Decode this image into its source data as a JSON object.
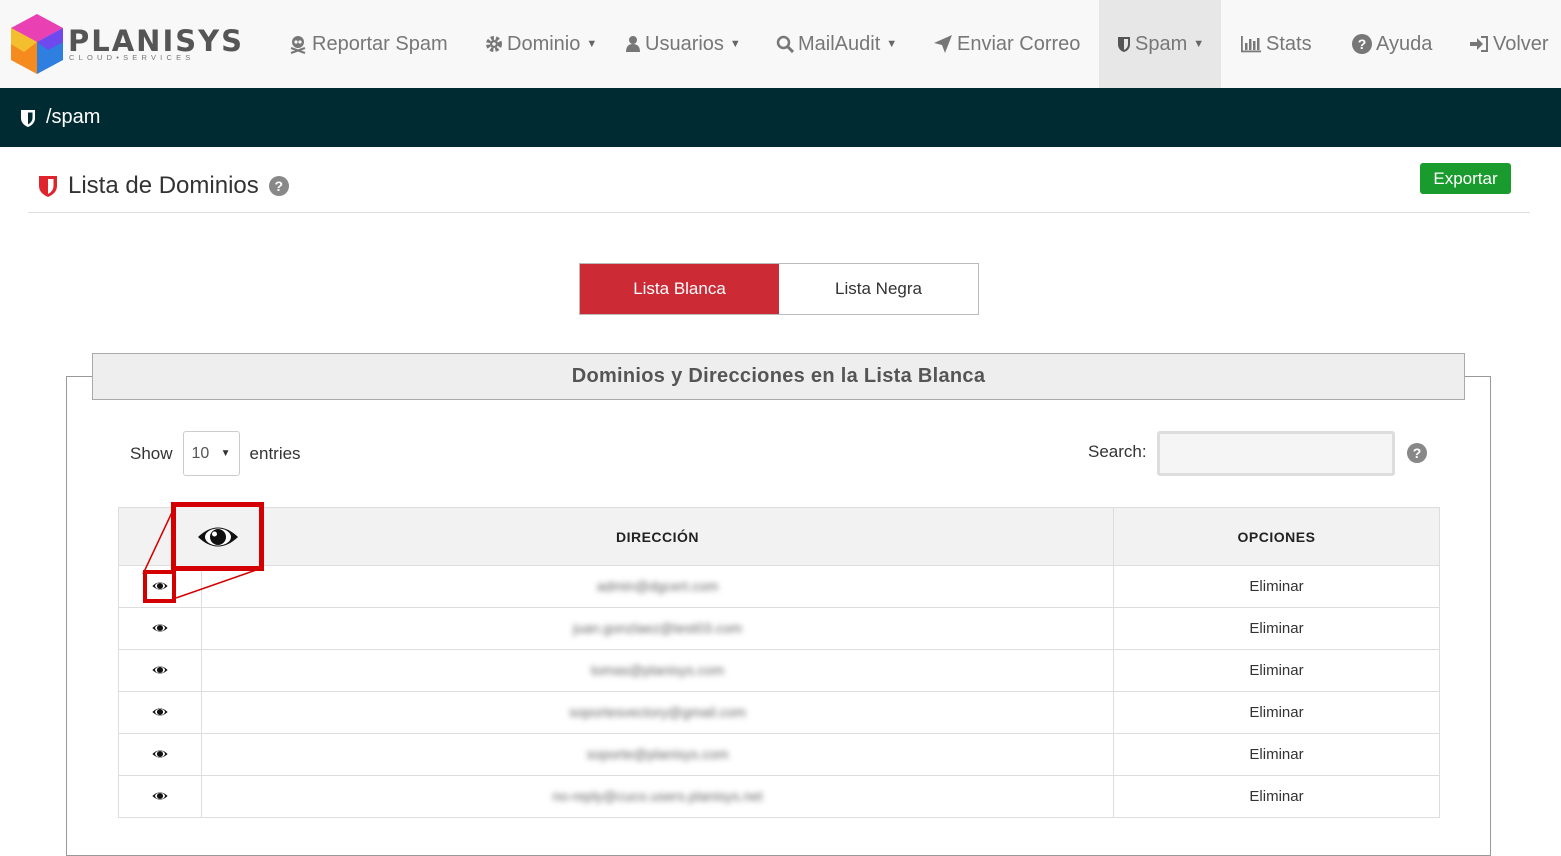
{
  "brand": {
    "name": "PLANISYS",
    "tagline": "CLOUD•SERVICES"
  },
  "nav": {
    "items": [
      {
        "label": "Reportar Spam",
        "icon": "skull-icon",
        "dropdown": false
      },
      {
        "label": "Dominio",
        "icon": "gear-icon",
        "dropdown": true
      },
      {
        "label": "Usuarios",
        "icon": "user-icon",
        "dropdown": true
      },
      {
        "label": "MailAudit",
        "icon": "search-icon",
        "dropdown": true
      },
      {
        "label": "Enviar Correo",
        "icon": "send-icon",
        "dropdown": false
      },
      {
        "label": "Spam",
        "icon": "shield-icon",
        "dropdown": true,
        "active": true
      },
      {
        "label": "Stats",
        "icon": "bar-chart-icon",
        "dropdown": false
      },
      {
        "label": "Ayuda",
        "icon": "help-icon",
        "dropdown": false
      },
      {
        "label": "Volver",
        "icon": "sign-in-icon",
        "dropdown": false
      }
    ]
  },
  "breadcrumb": {
    "path": "/spam"
  },
  "page": {
    "title": "Lista de Dominios",
    "help": "?",
    "export_label": "Exportar"
  },
  "tabs": [
    {
      "label": "Lista Blanca",
      "active": true
    },
    {
      "label": "Lista Negra",
      "active": false
    }
  ],
  "panel": {
    "title": "Dominios y Direcciones en la Lista Blanca",
    "show_label": "Show",
    "entries_value": "10",
    "entries_label": "entries",
    "search_label": "Search:",
    "search_value": "",
    "search_help": "?"
  },
  "table": {
    "headers": {
      "address": "DIRECCIÓN",
      "options": "OPCIONES"
    },
    "rows": [
      {
        "address": "admin@dgcert.com",
        "action": "Eliminar"
      },
      {
        "address": "juan.gonzlaez@test03.com",
        "action": "Eliminar"
      },
      {
        "address": "tomas@planisys.com",
        "action": "Eliminar"
      },
      {
        "address": "soportesvectory@gmail.com",
        "action": "Eliminar"
      },
      {
        "address": "soporte@planisys.com",
        "action": "Eliminar"
      },
      {
        "address": "no-reply@cuco.users.planisys.net",
        "action": "Eliminar"
      }
    ]
  },
  "colors": {
    "navbar_bg": "#f8f8f8",
    "breadcrumb_bg": "#002b33",
    "tab_active": "#cc2a35",
    "export_btn": "#1a9b2d",
    "callout": "#d40000"
  }
}
